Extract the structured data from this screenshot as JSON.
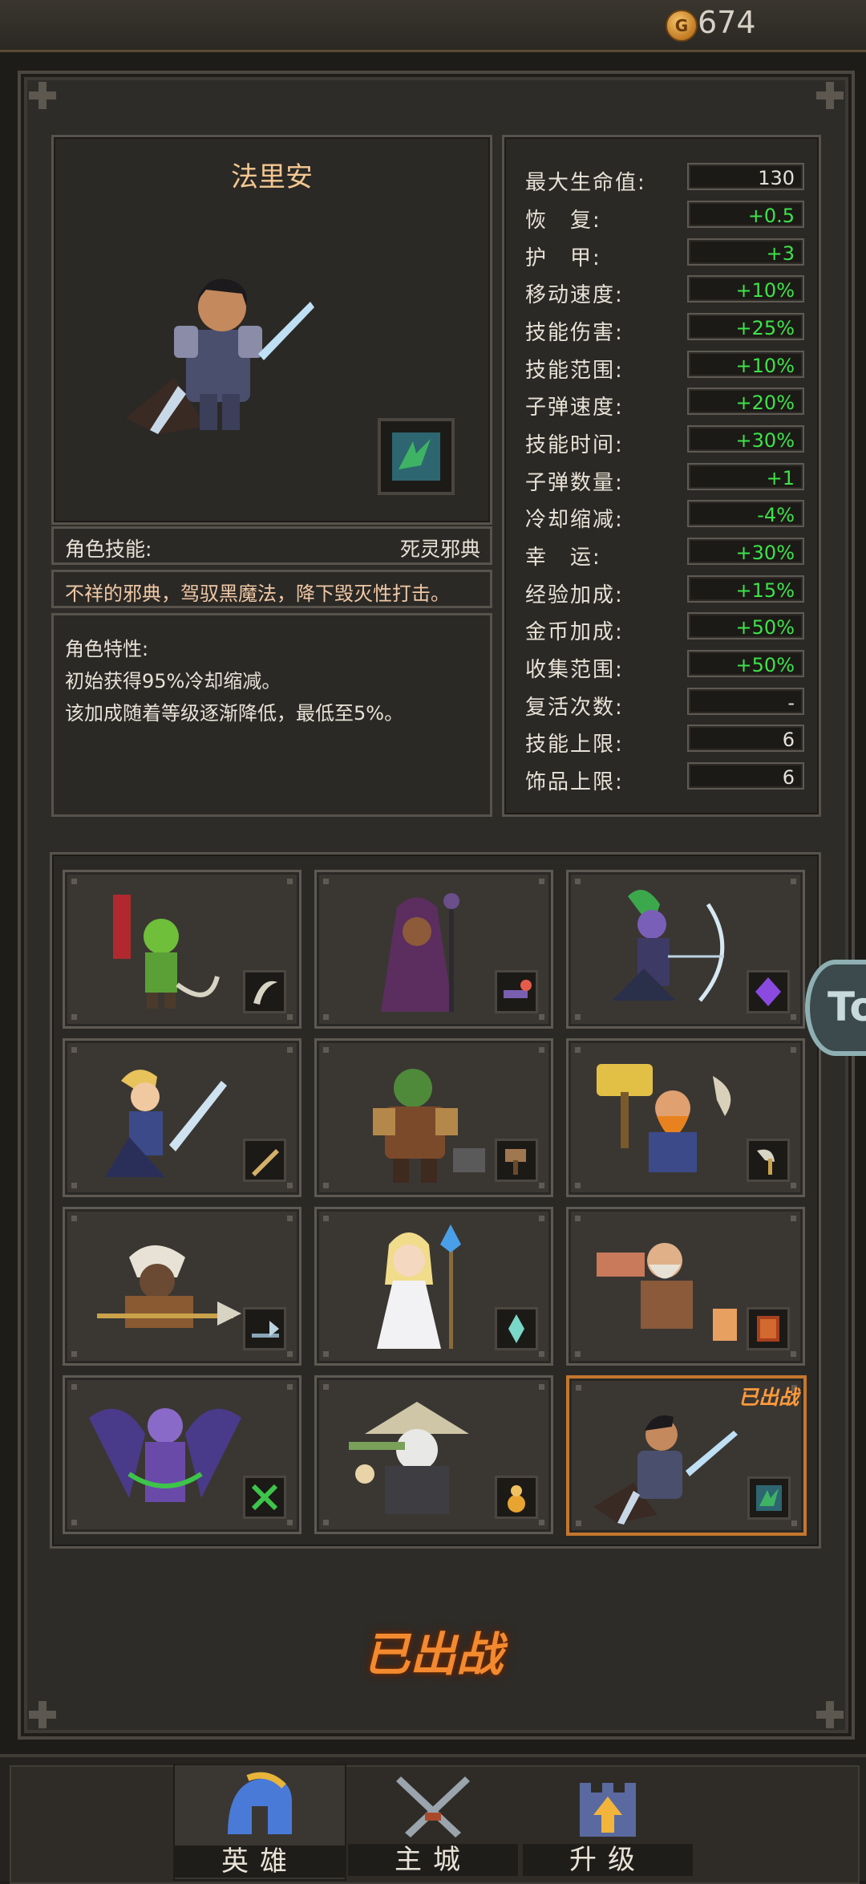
{
  "header": {
    "coin_icon_letter": "G",
    "coin_count": "674"
  },
  "hero": {
    "name": "法里安",
    "skill_label": "角色技能:",
    "skill_name": "死灵邪典",
    "skill_desc": "不祥的邪典，驾驭黑魔法，降下毁灭性打击。",
    "trait_title": "角色特性:",
    "trait_line1": "初始获得95%冷却缩减。",
    "trait_line2": "该加成随着等级逐渐降低，最低至5%。"
  },
  "stats": [
    {
      "label": "最大生命值:",
      "value": "130",
      "color": "white"
    },
    {
      "label": "恢　复:",
      "value": "+0.5",
      "color": "green"
    },
    {
      "label": "护　甲:",
      "value": "+3",
      "color": "green"
    },
    {
      "label": "移动速度:",
      "value": "+10%",
      "color": "green"
    },
    {
      "label": "技能伤害:",
      "value": "+25%",
      "color": "green"
    },
    {
      "label": "技能范围:",
      "value": "+10%",
      "color": "green"
    },
    {
      "label": "子弹速度:",
      "value": "+20%",
      "color": "green"
    },
    {
      "label": "技能时间:",
      "value": "+30%",
      "color": "green"
    },
    {
      "label": "子弹数量:",
      "value": "+1",
      "color": "green"
    },
    {
      "label": "冷却缩减:",
      "value": "-4%",
      "color": "green"
    },
    {
      "label": "幸　运:",
      "value": "+30%",
      "color": "green"
    },
    {
      "label": "经验加成:",
      "value": "+15%",
      "color": "green"
    },
    {
      "label": "金币加成:",
      "value": "+50%",
      "color": "green"
    },
    {
      "label": "收集范围:",
      "value": "+50%",
      "color": "green"
    },
    {
      "label": "复活次数:",
      "value": "-",
      "color": "white"
    },
    {
      "label": "技能上限:",
      "value": "6",
      "color": "white"
    },
    {
      "label": "饰品上限:",
      "value": "6",
      "color": "white"
    }
  ],
  "heroes_grid": {
    "deployed_tag": "已出战",
    "cards": [
      {
        "icon": "goblin-hero-icon",
        "weapon": "scimitar-icon"
      },
      {
        "icon": "dark-mage-hero-icon",
        "weapon": "staff-orb-icon"
      },
      {
        "icon": "elf-archer-hero-icon",
        "weapon": "purple-gem-icon"
      },
      {
        "icon": "paladin-hero-icon",
        "weapon": "sword-icon"
      },
      {
        "icon": "orc-warrior-hero-icon",
        "weapon": "hammer-icon"
      },
      {
        "icon": "dwarf-hero-icon",
        "weapon": "axe-icon"
      },
      {
        "icon": "tauren-hero-icon",
        "weapon": "halberd-icon"
      },
      {
        "icon": "priestess-hero-icon",
        "weapon": "crystal-icon"
      },
      {
        "icon": "sage-hero-icon",
        "weapon": "tome-icon"
      },
      {
        "icon": "demon-hunter-hero-icon",
        "weapon": "warglaive-icon"
      },
      {
        "icon": "panda-monk-hero-icon",
        "weapon": "gourd-icon"
      },
      {
        "icon": "necro-hero-icon",
        "weapon": "necro-book-icon",
        "active": true
      }
    ]
  },
  "deploy_status": "已出战",
  "nav": {
    "tabs": [
      {
        "label": "英雄",
        "icon": "helmet-icon"
      },
      {
        "label": "主城",
        "icon": "crossed-swords-icon"
      },
      {
        "label": "升级",
        "icon": "castle-upgrade-icon"
      }
    ]
  },
  "edge_button": {
    "text": "To"
  }
}
